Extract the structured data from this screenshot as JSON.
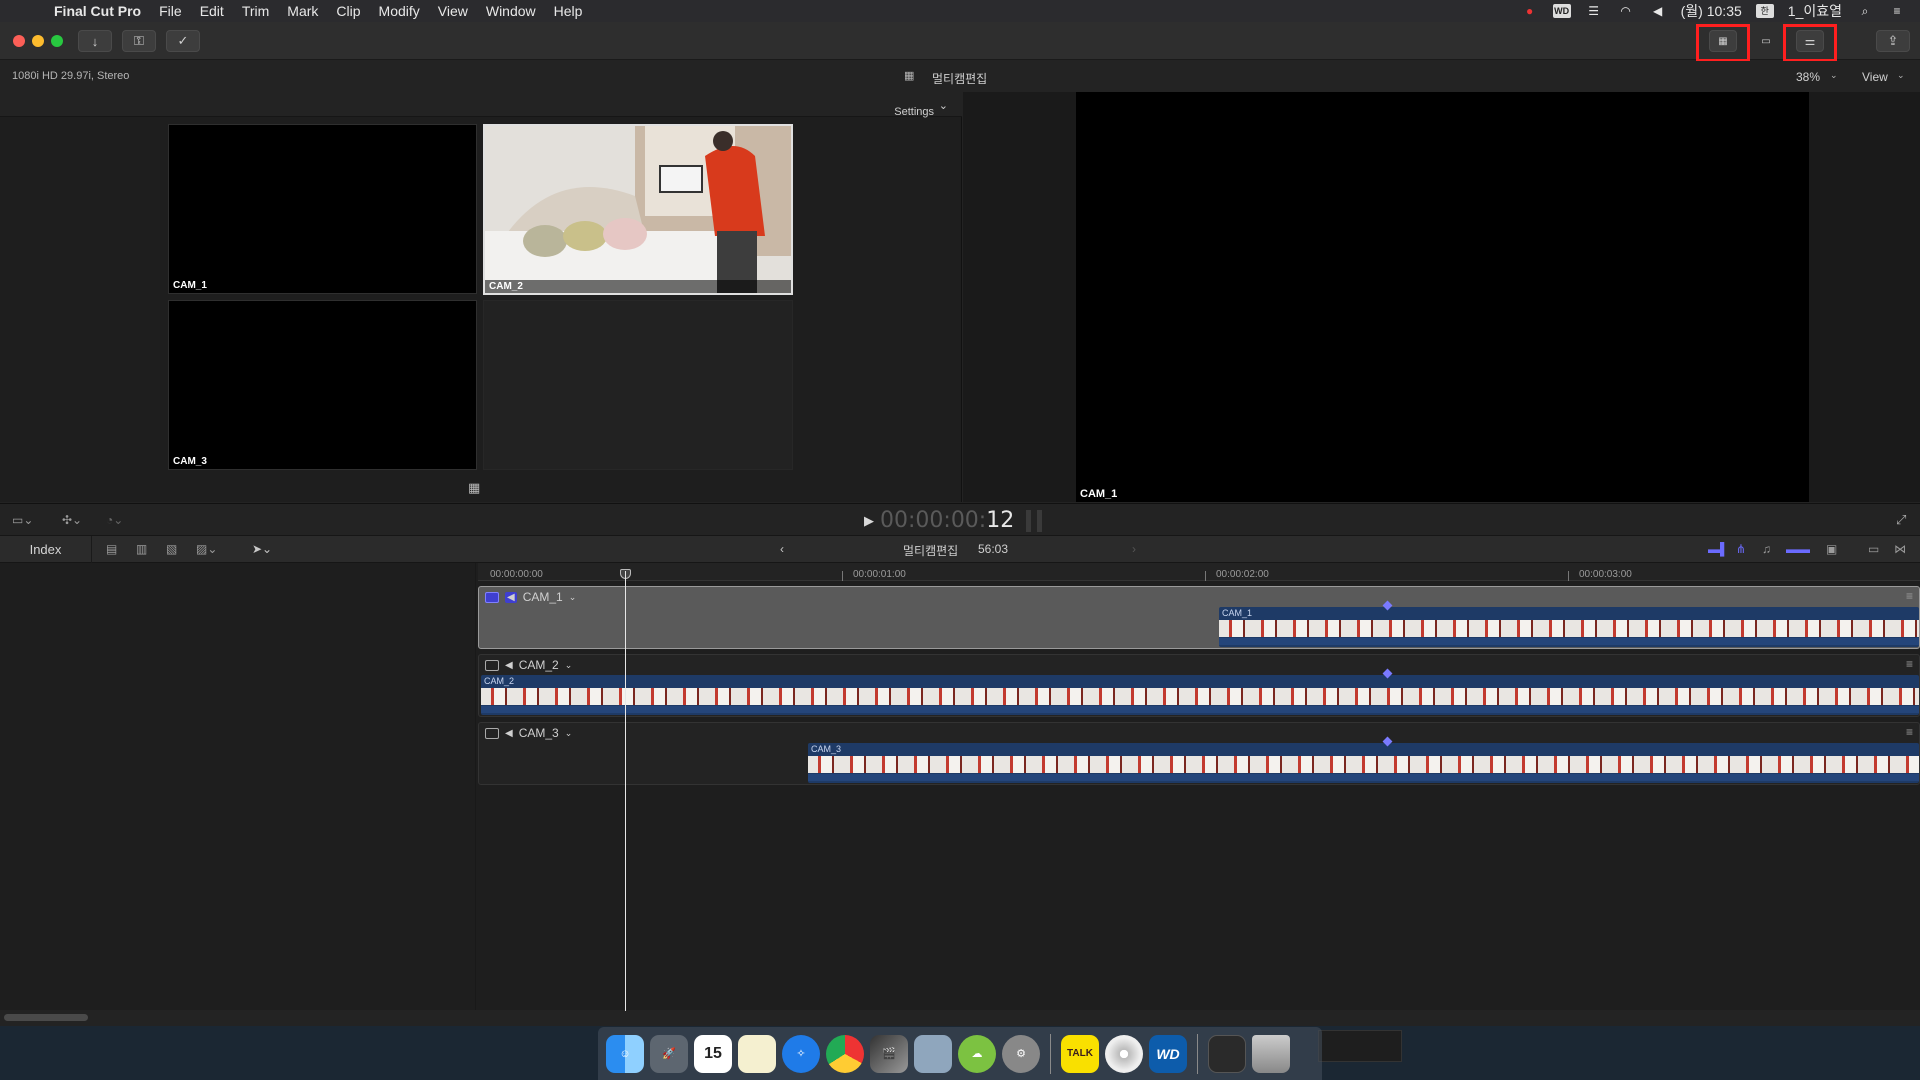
{
  "menubar": {
    "app_name": "Final Cut Pro",
    "items": [
      "File",
      "Edit",
      "Trim",
      "Mark",
      "Clip",
      "Modify",
      "View",
      "Window",
      "Help"
    ],
    "clock": "(월) 10:35",
    "user": "1_이효열",
    "status_icons": [
      "notification-icon",
      "wd-icon",
      "drive-icon",
      "wifi-icon",
      "volume-icon",
      "keyboard-icon",
      "search-icon",
      "list-icon"
    ]
  },
  "infobar": {
    "format": "1080i HD 29.97i, Stereo",
    "project_title": "멀티캠편집",
    "zoom": "38%",
    "view_label": "View"
  },
  "angle_viewer": {
    "settings_label": "Settings",
    "angles": [
      {
        "label": "CAM_1"
      },
      {
        "label": "CAM_2"
      },
      {
        "label": "CAM_3"
      }
    ],
    "viewer_label": "CAM_1"
  },
  "transport": {
    "timecode_dim": "00:00:00:",
    "timecode_frames": "12"
  },
  "timeline_toolbar": {
    "index_label": "Index",
    "title": "멀티캠편집",
    "duration": "56:03"
  },
  "timeline": {
    "ruler_ticks": [
      "00:00:00:00",
      "00:00:01:00",
      "00:00:02:00",
      "00:00:03:00"
    ],
    "lanes": [
      {
        "label": "CAM_1",
        "clip_name": "CAM_1",
        "selected": true
      },
      {
        "label": "CAM_2",
        "clip_name": "CAM_2",
        "selected": false
      },
      {
        "label": "CAM_3",
        "clip_name": "CAM_3",
        "selected": false
      }
    ]
  },
  "dock": {
    "calendar_day": "15",
    "items": [
      "finder-icon",
      "launchpad-icon",
      "calendar-icon",
      "notes-icon",
      "safari-icon",
      "chrome-icon",
      "final-cut-icon",
      "preview-icon",
      "cloud-download-icon",
      "system-preferences-icon",
      "kakaotalk-icon",
      "dvd-player-icon",
      "wd-app-icon",
      "downloads-stack-icon",
      "trash-icon"
    ],
    "kakao_label": "TALK",
    "wd_label": "WD"
  },
  "colors": {
    "accent_blue": "#3f3fd0",
    "highlight_red": "#ff1f1f",
    "clip_blue": "#1e3a66"
  }
}
